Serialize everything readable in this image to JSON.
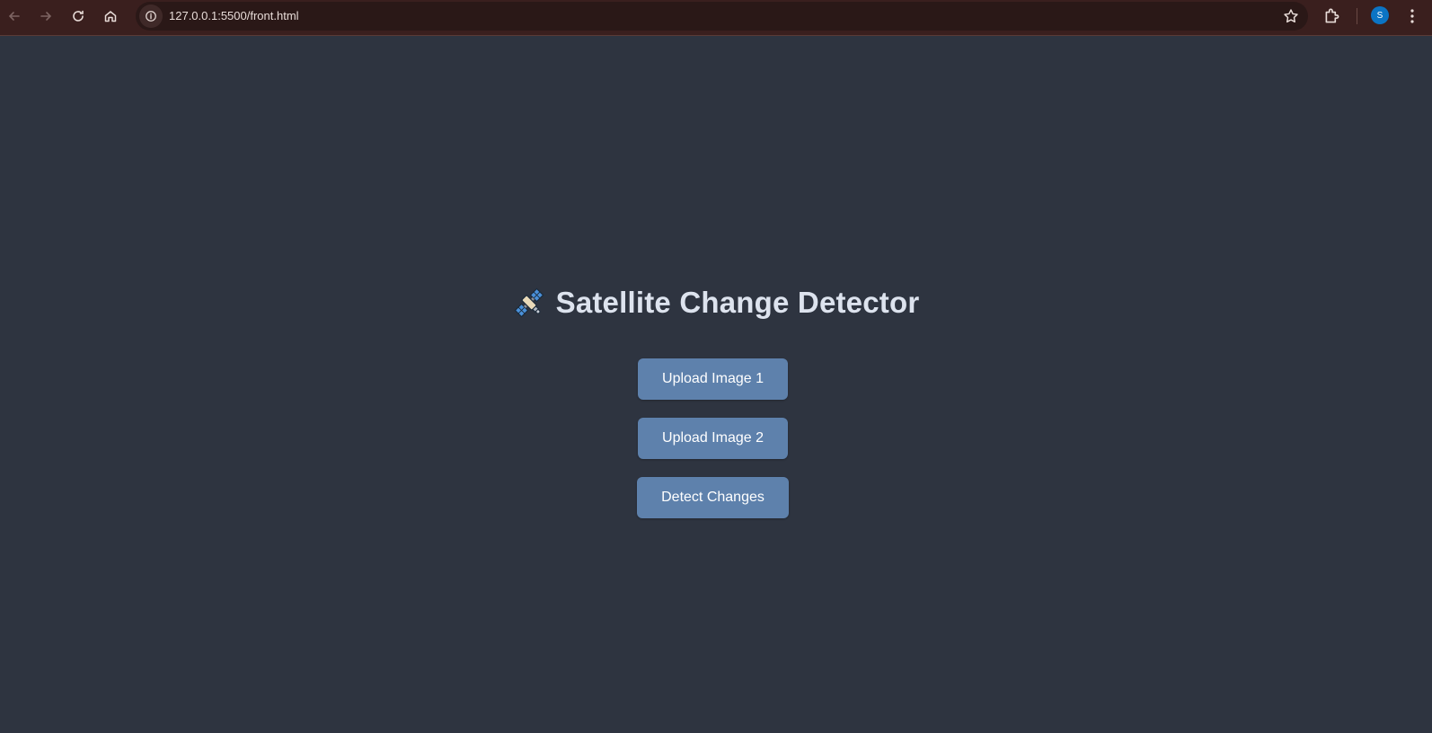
{
  "browser": {
    "url": "127.0.0.1:5500/front.html",
    "profile_initial": "S"
  },
  "main": {
    "title": "Satellite Change Detector",
    "title_icon": "satellite-icon",
    "buttons": {
      "upload1": "Upload Image 1",
      "upload2": "Upload Image 2",
      "detect": "Detect Changes"
    }
  },
  "colors": {
    "background": "#2e3440",
    "button": "#5e81ac",
    "browser_bar": "#3a1f1e"
  }
}
